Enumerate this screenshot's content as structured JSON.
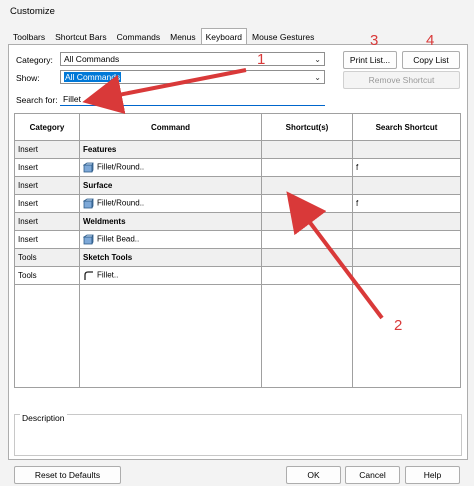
{
  "window": {
    "title": "Customize"
  },
  "tabs": [
    "Toolbars",
    "Shortcut Bars",
    "Commands",
    "Menus",
    "Keyboard",
    "Mouse Gestures"
  ],
  "form": {
    "category_label": "Category:",
    "category_value": "All Commands",
    "show_label": "Show:",
    "show_value": "All Commands",
    "search_label": "Search for:",
    "search_value": "Fillet"
  },
  "buttons": {
    "print_list": "Print List...",
    "copy_list": "Copy List",
    "remove_shortcut": "Remove Shortcut",
    "reset_defaults": "Reset to Defaults",
    "ok": "OK",
    "cancel": "Cancel",
    "help": "Help"
  },
  "table": {
    "headers": [
      "Category",
      "Command",
      "Shortcut(s)",
      "Search Shortcut"
    ],
    "rows": [
      {
        "category": "Insert",
        "command": "Features",
        "shortcut": "",
        "search": "",
        "header": true
      },
      {
        "category": "Insert",
        "command": "Fillet/Round..",
        "shortcut": "",
        "search": "f",
        "icon": "fillet-round-icon"
      },
      {
        "category": "Insert",
        "command": "Surface",
        "shortcut": "",
        "search": "",
        "header": true
      },
      {
        "category": "Insert",
        "command": "Fillet/Round..",
        "shortcut": "",
        "search": "f",
        "icon": "fillet-round-icon"
      },
      {
        "category": "Insert",
        "command": "Weldments",
        "shortcut": "",
        "search": "",
        "header": true
      },
      {
        "category": "Insert",
        "command": "Fillet Bead..",
        "shortcut": "",
        "search": "",
        "icon": "fillet-bead-icon"
      },
      {
        "category": "Tools",
        "command": "Sketch Tools",
        "shortcut": "",
        "search": "",
        "header": true
      },
      {
        "category": "Tools",
        "command": "Fillet..",
        "shortcut": "",
        "search": "",
        "icon": "sketch-fillet-icon"
      }
    ]
  },
  "description_label": "Description",
  "annotations": [
    "1",
    "2",
    "3",
    "4"
  ],
  "colors": {
    "annotation": "#d93939",
    "accent": "#0066cc"
  }
}
